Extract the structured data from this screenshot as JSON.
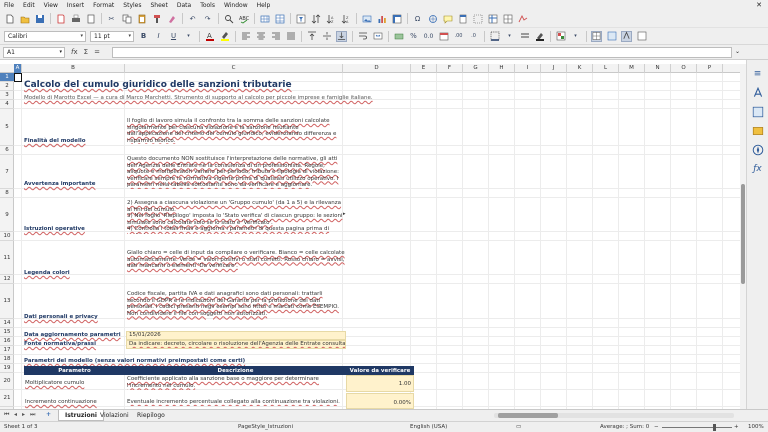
{
  "menubar": [
    "File",
    "Edit",
    "View",
    "Insert",
    "Format",
    "Styles",
    "Sheet",
    "Data",
    "Tools",
    "Window",
    "Help"
  ],
  "toolbar2": {
    "font_name": "Calibri",
    "font_size": "11 pt"
  },
  "formula_bar": {
    "cell_ref": "A1",
    "content": ""
  },
  "columns": [
    "A",
    "B",
    "C",
    "D",
    "E",
    "F",
    "G",
    "H",
    "I",
    "J",
    "K",
    "L",
    "M",
    "N",
    "O",
    "P"
  ],
  "rows": [
    "1",
    "2",
    "3",
    "4",
    "5",
    "6",
    "7",
    "8",
    "9",
    "10",
    "11",
    "12",
    "13",
    "14",
    "15",
    "16",
    "17",
    "18",
    "19",
    "20",
    "21"
  ],
  "sheet": {
    "title": "Calcolo del cumulo giuridico delle sanzioni tributarie",
    "subtitle": "Modello di Marotto Excel — a cura di Marco Marchetti. Strumento di supporto al calcolo per piccole imprese e famiglie italiane.",
    "sections": [
      {
        "label": "Finalità del modello",
        "text": "Il foglio di lavoro simula il confronto tra la somma delle sanzioni calcolate singolarmente per ciascuna violazione e la sanzione risultante dall'applicazione del criterio del cumulo giuridico, evidenziando differenza e risparmio teorico."
      },
      {
        "label": "Avvertenza importante",
        "text": "Questo documento NON sostituisce l'interpretazione delle normative, gli atti dell'Agenzia delle Entrate né la consulenza di un professionista. Regole, aliquote e moltiplicatori variano per periodo, tributo e tipologia di violazione: verificare sempre la normativa vigente prima di qualsiasi utilizzo operativo. I parametri nella tabella sottostante sono da verificare e aggiornare."
      },
      {
        "label": "Istruzioni operative",
        "text": "2) Assegna a ciascuna violazione un 'Gruppo cumulo' (da 1 a 5) e la rilevanza ai fini del cumulo.\n3) Nel foglio 'Riepilogo' imposta lo 'Stato verifica' di ciascun gruppo: le sezioni simulate sono calcolate solo se lo stato è 'Verificato'.\n4) Controlla i totali finali e aggiorna i parametri di questa pagina prima di archiviare."
      },
      {
        "label": "Legenda colori",
        "text": "Giallo chiaro = celle di input da compilare o verificare. Bianco = celle calcolate automaticamente. Verde = valori positivi o stati corretti. Rosso chiaro = avvisi, dati mancanti o elementi 'Da verificare'."
      },
      {
        "label": "Dati personali e privacy",
        "text": "Codice fiscale, partita IVA e dati anagrafici sono dati personali: trattarli secondo il GDPR e le indicazioni del Garante per la protezione dei dati personali. I codici presenti negli esempi sono fittizi e marcati come ESEMPIO. Non condividere il file con soggetti non autorizzati."
      }
    ],
    "update_label": "Data aggiornamento parametri",
    "update_value": "15/01/2026",
    "source_label": "Fonte normativa/prassi",
    "source_value": "Da indicare: decreto, circolare o risoluzione dell'Agenzia delle Entrate consultata",
    "params_title": "Parametri del modello (senza valori normativi preimpostati come certi)",
    "table_headers": [
      "Parametro",
      "Descrizione",
      "Valore da verificare"
    ],
    "table_rows": [
      {
        "param": "Moltiplicatore cumulo",
        "desc": "Coefficiente applicato alla sanzione base o maggiore per determinare l'incremento nel cumulo.",
        "value": "1.00"
      },
      {
        "param": "Incremento continuazione",
        "desc": "Eventuale incremento percentuale collegato alla continuazione tra violazioni.",
        "value": "0.00%"
      }
    ]
  },
  "sheet_tabs": [
    "Istruzioni",
    "Violazioni",
    "Riepilogo"
  ],
  "status": {
    "sheet_info": "Sheet 1 of 3",
    "page_style": "PageStyle_Istruzioni",
    "language": "English (USA)",
    "summary": "Average: ; Sum: 0",
    "zoom": "100%"
  },
  "colors": {
    "header_navy": "#1f3864",
    "selection_blue": "#4f81bd",
    "input_yellow": "#fff2cc"
  }
}
